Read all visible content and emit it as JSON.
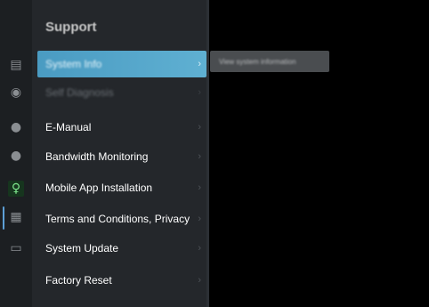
{
  "panel": {
    "title": "Support"
  },
  "rail": {
    "icons": [
      {
        "name": "source-icon",
        "glyph": "▤"
      },
      {
        "name": "network-icon",
        "glyph": "◉"
      },
      {
        "name": "globe-icon",
        "glyph": "●"
      },
      {
        "name": "settings-icon",
        "glyph": "●"
      },
      {
        "name": "accessibility-icon",
        "glyph": "♀"
      },
      {
        "name": "support-icon",
        "glyph": "▦"
      },
      {
        "name": "apps-icon",
        "glyph": "▭"
      }
    ]
  },
  "menu": {
    "items": [
      {
        "label": "System Info",
        "state": "selected"
      },
      {
        "label": "Self Diagnosis",
        "state": "dimmed"
      },
      {
        "label": "E-Manual",
        "state": "normal"
      },
      {
        "label": "Bandwidth Monitoring",
        "state": "normal"
      },
      {
        "label": "Mobile App Installation",
        "state": "normal"
      },
      {
        "label": "Terms and Conditions, Privacy",
        "state": "normal"
      },
      {
        "label": "System Update",
        "state": "normal"
      },
      {
        "label": "Factory Reset",
        "state": "normal"
      }
    ],
    "chevron": "›"
  },
  "tooltip": {
    "text": "View system information"
  },
  "colors": {
    "selected_background": "#4a9bc2",
    "panel_background": "#24272b",
    "rail_background": "#1c1f22",
    "active_rail_icon": "#7ee68c",
    "rail_accent": "#5d9fd6"
  }
}
